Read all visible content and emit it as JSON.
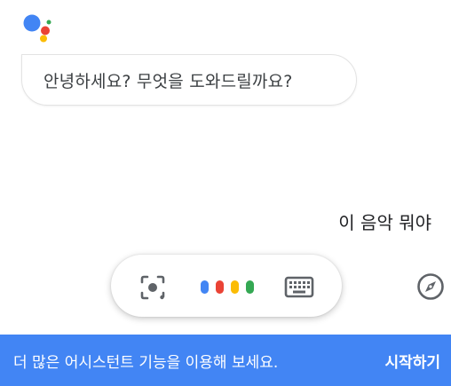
{
  "conversation": {
    "greeting": "안녕하세요? 무엇을 도와드릴까요?",
    "user_query": "이 음악 뭐야"
  },
  "input_bar": {
    "lens_icon": "lens-icon",
    "mic_icon": "assistant-dots-icon",
    "keyboard_icon": "keyboard-icon",
    "dot_colors": [
      "#4285f4",
      "#ea4335",
      "#fbbc05",
      "#34a853"
    ]
  },
  "explore": {
    "icon": "compass-icon"
  },
  "banner": {
    "text": "더 많은 어시스턴트 기능을 이용해 보세요.",
    "action": "시작하기",
    "color": "#4285f4"
  },
  "logo_colors": {
    "blue": "#4285f4",
    "red": "#ea4335",
    "yellow": "#fbbc05",
    "green": "#34a853"
  }
}
